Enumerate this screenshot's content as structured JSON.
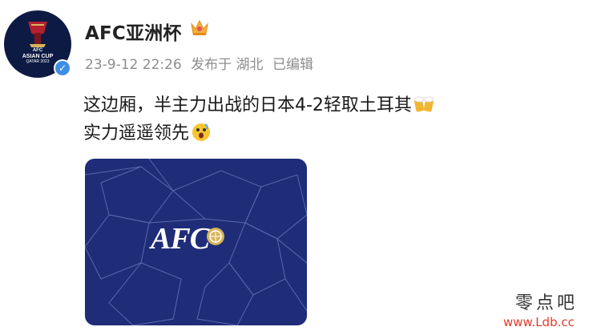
{
  "avatar": {
    "line1": "AFC",
    "line2": "ASIAN CUP",
    "line3": "QATAR 2023"
  },
  "account": {
    "name": "AFC亚洲杯",
    "badge_icon": "crown-icon",
    "verified_icon": "verified-check-icon"
  },
  "meta": {
    "datetime": "23-9-12 22:26",
    "location": "发布于 湖北",
    "edited": "已编辑"
  },
  "post": {
    "line1": "这边厢，半主力出战的日本4-2轻取土耳其",
    "line1_emoji": "beer-cheers-icon",
    "line2": "实力遥遥领先",
    "line2_emoji": "shocked-face-icon"
  },
  "image": {
    "logo_text": "AFC",
    "background_color": "#1f2c78"
  },
  "watermark": {
    "cn": "零点吧",
    "url": "www.Ldb.cc"
  }
}
